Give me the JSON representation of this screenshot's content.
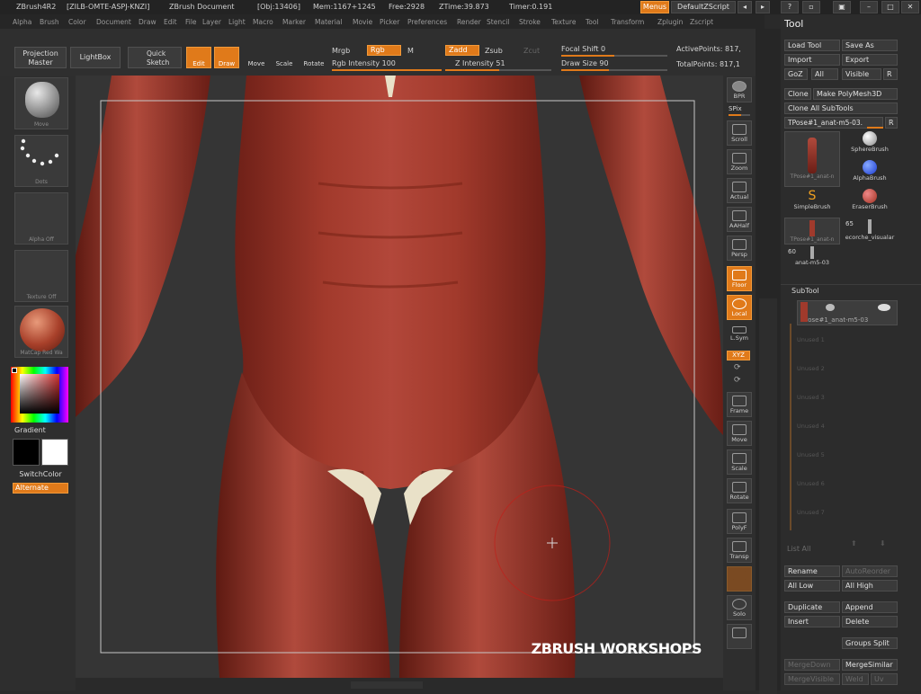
{
  "titlebar": {
    "app": "ZBrush4R2",
    "build": "[ZILB-OMTE-ASPJ-KNZI]",
    "doc": "ZBrush Document",
    "obj": "[Obj:13406]",
    "mem": "Mem:1167+1245",
    "free": "Free:2928",
    "ztime": "ZTime:39.873",
    "timer": "Timer:0.191",
    "menus_btn": "Menus",
    "zscript": "DefaultZScript"
  },
  "menubar": [
    "Alpha",
    "Brush",
    "Color",
    "Document",
    "Draw",
    "Edit",
    "File",
    "Layer",
    "Light",
    "Macro",
    "Marker",
    "Material",
    "Movie",
    "Picker",
    "Preferences",
    "Render",
    "Stencil",
    "Stroke",
    "Texture",
    "Tool",
    "Transform",
    "Zplugin",
    "Zscript"
  ],
  "toolbar": {
    "projection_master": "Projection Master",
    "lightbox": "LightBox",
    "quick_sketch": "Quick Sketch",
    "edit": "Edit",
    "draw": "Draw",
    "move": "Move",
    "scale": "Scale",
    "rotate": "Rotate",
    "mrgb": "Mrgb",
    "rgb": "Rgb",
    "m": "M",
    "rgb_intensity": "Rgb Intensity 100",
    "zadd": "Zadd",
    "zsub": "Zsub",
    "zcut": "Zcut",
    "z_intensity": "Z Intensity 51",
    "focal_shift": "Focal Shift 0",
    "draw_size": "Draw Size 90",
    "active_points": "ActivePoints: 817,",
    "total_points": "TotalPoints: 817,1"
  },
  "leftshelf": {
    "brush": "Move",
    "stroke": "Dots",
    "alpha": "Alpha Off",
    "texture": "Texture Off",
    "material": "MatCap Red Wa",
    "gradient": "Gradient",
    "switchcolor": "SwitchColor",
    "alternate": "Alternate"
  },
  "rightshelf": [
    "BPR",
    "SPix",
    "Scroll",
    "Zoom",
    "Actual",
    "AAHalf",
    "Persp",
    "Floor",
    "Local",
    "L.Sym",
    "XYZ",
    "Frame",
    "Move",
    "Scale",
    "Rotate",
    "PolyF",
    "Transp",
    "Solo"
  ],
  "watermark": "ZBRUSH WORKSHOPS",
  "panel": {
    "title": "Tool",
    "load_tool": "Load Tool",
    "save_as": "Save As",
    "import": "Import",
    "export": "Export",
    "goz": "GoZ",
    "all": "All",
    "visible": "Visible",
    "r": "R",
    "clone": "Clone",
    "make_polymesh": "Make PolyMesh3D",
    "clone_all": "Clone All SubTools",
    "current_tool": "TPose#1_anat-m5-03.",
    "tools": [
      {
        "label": "TPose#1_anat-n"
      },
      {
        "label": "SphereBrush"
      },
      {
        "label": "SimpleBrush"
      },
      {
        "label": "AlphaBrush"
      },
      {
        "label": "EraserBrush"
      },
      {
        "label": "TPose#1_anat-n"
      },
      {
        "label": "ecorche_visualar"
      },
      {
        "label": "anat-m5-03"
      }
    ],
    "count_65": "65",
    "count_60": "60",
    "subtool": "SubTool",
    "subtool_active": "TPose#1_anat-m5-03",
    "subtool_empty": [
      "Unused 1",
      "Unused 2",
      "Unused 3",
      "Unused 4",
      "Unused 5",
      "Unused 6",
      "Unused 7"
    ],
    "list_all": "List All",
    "rename": "Rename",
    "autoreorder": "AutoReorder",
    "all_low": "All Low",
    "all_high": "All High",
    "duplicate": "Duplicate",
    "append": "Append",
    "insert": "Insert",
    "delete": "Delete",
    "groups_split": "Groups Split",
    "mergedown": "MergeDown",
    "mergesimilar": "MergeSimilar",
    "mergevisible": "MergeVisible",
    "weld": "Weld",
    "uv": "Uv"
  }
}
